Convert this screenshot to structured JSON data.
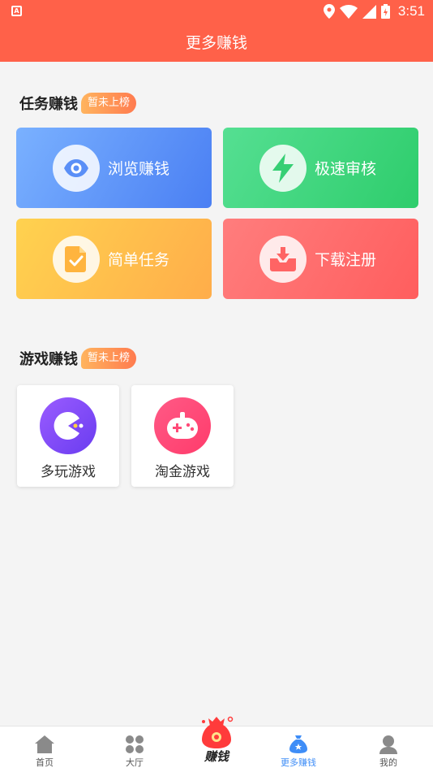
{
  "status_bar": {
    "time": "3:51",
    "app_indicator": "A"
  },
  "header": {
    "title": "更多赚钱"
  },
  "task_section": {
    "title": "任务赚钱",
    "badge": "暂未上榜",
    "cards": [
      {
        "label": "浏览赚钱",
        "icon": "eye-icon",
        "color": "#5a8ff7"
      },
      {
        "label": "极速审核",
        "icon": "lightning-icon",
        "color": "#3dd37a"
      },
      {
        "label": "简单任务",
        "icon": "document-check-icon",
        "color": "#ffc14d"
      },
      {
        "label": "下载注册",
        "icon": "download-tray-icon",
        "color": "#ff6b6b"
      }
    ]
  },
  "game_section": {
    "title": "游戏赚钱",
    "badge": "暂未上榜",
    "games": [
      {
        "name": "多玩游戏",
        "icon": "pacman-icon",
        "color": "#7b4df5"
      },
      {
        "name": "淘金游戏",
        "icon": "gamepad-icon",
        "color": "#ff4b78"
      }
    ]
  },
  "tab_bar": {
    "tabs": [
      {
        "label": "首页",
        "icon": "home-icon"
      },
      {
        "label": "大厅",
        "icon": "grid-icon"
      },
      {
        "label": "赚钱",
        "icon": "money-bag-icon"
      },
      {
        "label": "更多赚钱",
        "icon": "money-sack-icon",
        "active": true
      },
      {
        "label": "我的",
        "icon": "profile-icon"
      }
    ],
    "active_color": "#3e8df7"
  }
}
